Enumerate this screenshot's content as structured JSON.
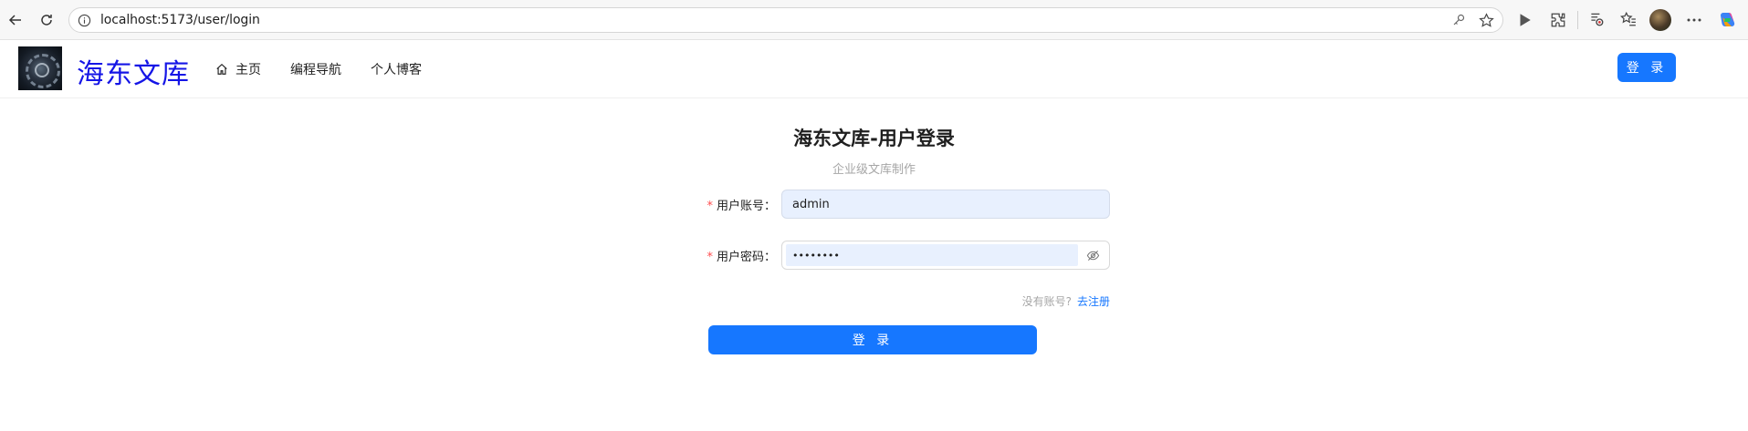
{
  "browser": {
    "url": "localhost:5173/user/login"
  },
  "header": {
    "site_title": "海东文库",
    "nav": [
      {
        "label": "主页",
        "icon": "home-icon"
      },
      {
        "label": "编程导航"
      },
      {
        "label": "个人博客"
      }
    ],
    "login_label": "登 录"
  },
  "login": {
    "title": "海东文库-用户登录",
    "subtitle": "企业级文库制作",
    "account_label": "用户账号",
    "account_value": "admin",
    "password_label": "用户密码",
    "password_value": "••••••••",
    "register_hint": "没有账号?",
    "register_link": "去注册",
    "submit_label": "登 录"
  },
  "colors": {
    "primary": "#1677ff",
    "site_title": "#1515e6",
    "required": "#ff4d4f",
    "autofill": "#e8f0fe"
  }
}
